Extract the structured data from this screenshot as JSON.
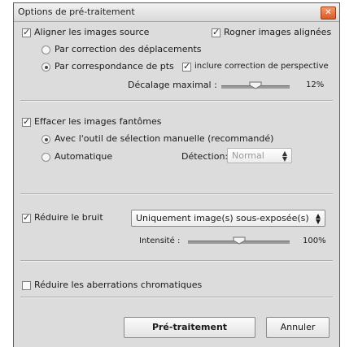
{
  "window": {
    "title": "Options de pré-traitement"
  },
  "align": {
    "label": "Aligner les images source",
    "checked": true,
    "crop_label": "Rogner images alignées",
    "crop_checked": true,
    "option_displacement": "Par correction des déplacements",
    "option_points": "Par correspondance de pts",
    "selected": "points",
    "perspective_label": "inclure correction de perspective",
    "perspective_checked": true,
    "offset_label": "Décalage maximal :",
    "offset_value": "12%",
    "offset_fraction": 0.5
  },
  "ghost": {
    "label": "Effacer les images fantômes",
    "checked": true,
    "option_manual": "Avec l'outil de sélection manuelle (recommandé)",
    "option_auto": "Automatique",
    "selected": "manual",
    "detection_label": "Détection:",
    "detection_value": "Normal"
  },
  "noise": {
    "label": "Réduire le bruit",
    "checked": true,
    "mode_value": "Uniquement image(s) sous-exposée(s)",
    "intensity_label": "Intensité :",
    "intensity_value": "100%",
    "intensity_fraction": 0.5
  },
  "aberration": {
    "label": "Réduire les aberrations chromatiques",
    "checked": false
  },
  "buttons": {
    "pretreat": "Pré-traitement",
    "cancel": "Annuler"
  }
}
